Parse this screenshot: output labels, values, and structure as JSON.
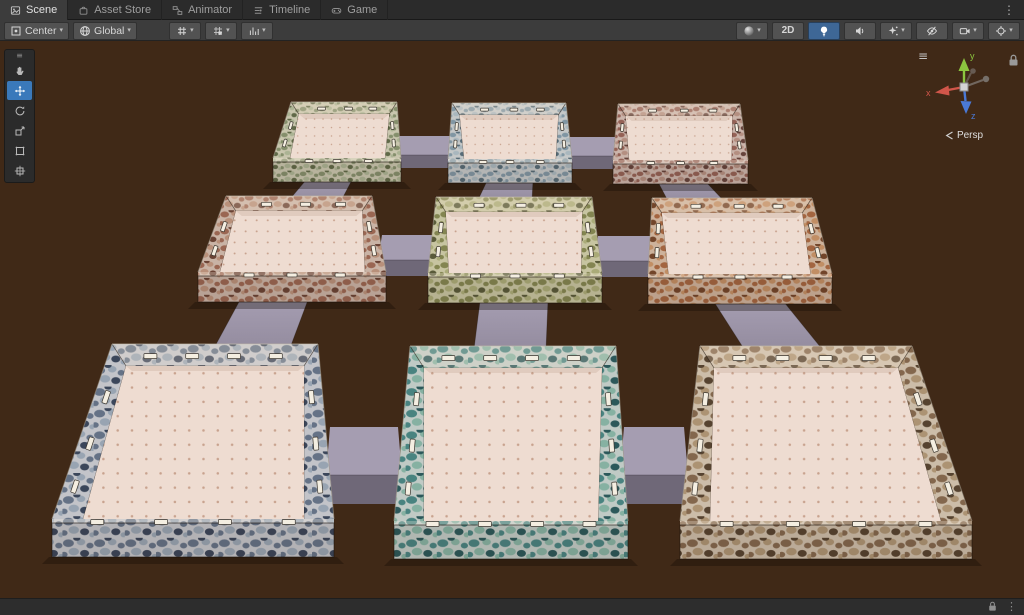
{
  "ui_glyphs": {
    "caret": "▾",
    "kebab": "⋮",
    "menu": "≡"
  },
  "tabs": [
    {
      "label": "Scene",
      "icon": "scene-icon",
      "active": true
    },
    {
      "label": "Asset Store",
      "icon": "asset-store-icon",
      "active": false
    },
    {
      "label": "Animator",
      "icon": "animator-icon",
      "active": false
    },
    {
      "label": "Timeline",
      "icon": "timeline-icon",
      "active": false
    },
    {
      "label": "Game",
      "icon": "game-icon",
      "active": false
    }
  ],
  "scene_toolbar": {
    "pivot": {
      "label": "Center",
      "icon": "pivot-icon"
    },
    "orientation": {
      "label": "Global",
      "icon": "globe-icon"
    },
    "snap_buttons": [
      {
        "name": "grid-visibility",
        "icon": "grid-icon"
      },
      {
        "name": "grid-snap",
        "icon": "grid-snap-icon"
      },
      {
        "name": "snap-increment",
        "icon": "snap-bars-icon"
      }
    ],
    "right_buttons": [
      {
        "name": "shading-mode",
        "icon": "shaded-sphere-icon",
        "dropdown": true,
        "active": false
      },
      {
        "name": "2d-view",
        "label": "2D",
        "dropdown": false,
        "active": false
      },
      {
        "name": "scene-lighting",
        "icon": "light-bulb-icon",
        "dropdown": false,
        "active": true
      },
      {
        "name": "scene-audio",
        "icon": "speaker-icon",
        "dropdown": false,
        "active": false
      },
      {
        "name": "effects",
        "icon": "effects-icon",
        "dropdown": true,
        "active": false
      },
      {
        "name": "scene-visibility",
        "icon": "eye-hidden-icon",
        "dropdown": false,
        "active": false
      },
      {
        "name": "camera-view",
        "icon": "camera-icon",
        "dropdown": true,
        "active": false
      },
      {
        "name": "gizmos",
        "icon": "crosshair-icon",
        "dropdown": true,
        "active": false
      }
    ]
  },
  "tool_palette": [
    {
      "name": "view-tool",
      "icon": "hand-icon",
      "active": false
    },
    {
      "name": "move-tool",
      "icon": "move-icon",
      "active": true
    },
    {
      "name": "rotate-tool",
      "icon": "rotate-icon",
      "active": false
    },
    {
      "name": "scale-tool",
      "icon": "scale-icon",
      "active": false
    },
    {
      "name": "rect-tool",
      "icon": "rect-icon",
      "active": false
    },
    {
      "name": "transform-tool",
      "icon": "transform-icon",
      "active": false
    }
  ],
  "orientation_gizmo": {
    "x_label": "x",
    "y_label": "y",
    "z_label": "z",
    "projection_label": "Persp",
    "x_color": "#d0564a",
    "y_color": "#8cc63f",
    "z_color": "#4a79d6"
  },
  "viewport": {
    "background_color": "#402917",
    "floor": {
      "base": "#eedcd1",
      "dot": "#c8a28e"
    },
    "corridor": {
      "top": "#a59db1",
      "side": "#6f6878",
      "slope": "#948c9f"
    },
    "rooms": [
      {
        "name": "room-1",
        "wall_palette": {
          "base": "#c9c6ae",
          "stone_a": "#7f8a66",
          "stone_b": "#a9b191",
          "stone_dark": "#57613f"
        }
      },
      {
        "name": "room-2",
        "wall_palette": {
          "base": "#c5c8c8",
          "stone_a": "#7b92a0",
          "stone_b": "#a7b6bd",
          "stone_dark": "#4d6370"
        }
      },
      {
        "name": "room-3",
        "wall_palette": {
          "base": "#cbb5ab",
          "stone_a": "#8f5a4e",
          "stone_b": "#b28c7e",
          "stone_dark": "#5e3a32"
        }
      },
      {
        "name": "room-4",
        "wall_palette": {
          "base": "#c9b3a5",
          "stone_a": "#96604b",
          "stone_b": "#b78d76",
          "stone_dark": "#623a2b"
        }
      },
      {
        "name": "room-5",
        "wall_palette": {
          "base": "#c7c4a1",
          "stone_a": "#7d804a",
          "stone_b": "#a7aa74",
          "stone_dark": "#4f5230"
        }
      },
      {
        "name": "room-6",
        "wall_palette": {
          "base": "#cdb29b",
          "stone_a": "#a05f39",
          "stone_b": "#c08b60",
          "stone_dark": "#6b3c21"
        }
      },
      {
        "name": "room-7",
        "wall_palette": {
          "base": "#c3c4c9",
          "stone_a": "#5e6c80",
          "stone_b": "#95a2b0",
          "stone_dark": "#303c50"
        }
      },
      {
        "name": "room-8",
        "wall_palette": {
          "base": "#c0cac5",
          "stone_a": "#3f7d7b",
          "stone_b": "#81afa0",
          "stone_dark": "#1f4e52"
        }
      },
      {
        "name": "room-9",
        "wall_palette": {
          "base": "#ccbda9",
          "stone_a": "#7d6046",
          "stone_b": "#aa906f",
          "stone_dark": "#4c3826"
        }
      }
    ]
  }
}
